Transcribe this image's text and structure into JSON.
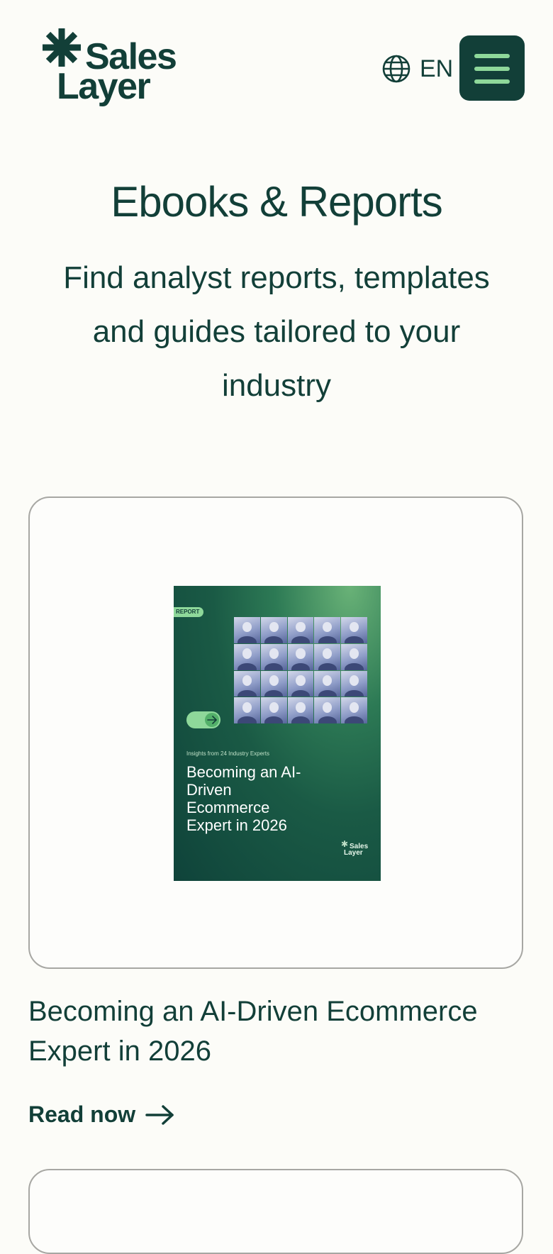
{
  "header": {
    "logo_line1": "Sales",
    "logo_line2": "Layer",
    "language_code": "EN",
    "globe_icon": "globe-icon",
    "menu_icon": "hamburger-menu-icon"
  },
  "hero": {
    "title": "Ebooks & Reports",
    "subtitle": "Find analyst reports, templates and guides tailored to your industry"
  },
  "cards": [
    {
      "cover": {
        "badge": "REPORT",
        "kicker": "Insights from 24 Industry Experts",
        "title": "Becoming an AI-Driven Ecommerce Expert in 2026",
        "logo_line1": "Sales",
        "logo_line2": "Layer"
      },
      "title": "Becoming an AI-Driven Ecommerce Expert in 2026",
      "cta_label": "Read now",
      "cta_icon": "arrow-right-icon"
    }
  ],
  "colors": {
    "brand_dark": "#123f38",
    "brand_accent": "#8ed89a",
    "background": "#fcfcf8",
    "card_border": "#a7a7a3"
  }
}
